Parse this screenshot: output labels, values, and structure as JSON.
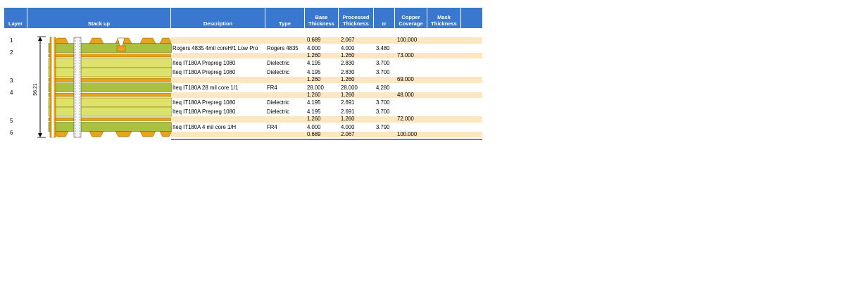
{
  "headers": {
    "layer": "Layer",
    "stackup": "Stack up",
    "description": "Description",
    "type": "Type",
    "base_thickness": "Base\nThickness",
    "processed_thickness": "Processed\nThickness",
    "er": "εr",
    "copper_coverage": "Copper\nCoverage",
    "mask_thickness": "Mask\nThickness"
  },
  "layers": [
    "1",
    "2",
    "3",
    "4",
    "5",
    "6"
  ],
  "total_thickness": "56.21",
  "rows": [
    {
      "kind": "cu",
      "description": "",
      "type": "",
      "base": "0.689",
      "processed": "2.067",
      "er": "",
      "coverage": "100.000"
    },
    {
      "kind": "die",
      "description": "Rogers 4835 4mil coreH/1 Low Pro",
      "type": "Rogers 4835",
      "base": "4.000",
      "processed": "4.000",
      "er": "3.480",
      "coverage": ""
    },
    {
      "kind": "cu",
      "description": "",
      "type": "",
      "base": "1.260",
      "processed": "1.260",
      "er": "",
      "coverage": "73.000"
    },
    {
      "kind": "die",
      "description": "Iteq IT180A Prepreg 1080",
      "type": "Dielectric",
      "base": "4.195",
      "processed": "2.830",
      "er": "3.700",
      "coverage": ""
    },
    {
      "kind": "die",
      "description": "Iteq IT180A Prepreg 1080",
      "type": "Dielectric",
      "base": "4.195",
      "processed": "2.830",
      "er": "3.700",
      "coverage": ""
    },
    {
      "kind": "cu",
      "description": "",
      "type": "",
      "base": "1.260",
      "processed": "1.260",
      "er": "",
      "coverage": "69.000"
    },
    {
      "kind": "die",
      "description": "Iteq IT180A 28 mil core 1/1",
      "type": "FR4",
      "base": "28.000",
      "processed": "28.000",
      "er": "4.280",
      "coverage": ""
    },
    {
      "kind": "cu",
      "description": "",
      "type": "",
      "base": "1.260",
      "processed": "1.260",
      "er": "",
      "coverage": "48.000"
    },
    {
      "kind": "die",
      "description": "Iteq IT180A Prepreg 1080",
      "type": "Dielectric",
      "base": "4.195",
      "processed": "2.691",
      "er": "3.700",
      "coverage": ""
    },
    {
      "kind": "die",
      "description": "Iteq IT180A Prepreg 1080",
      "type": "Dielectric",
      "base": "4.195",
      "processed": "2.691",
      "er": "3.700",
      "coverage": ""
    },
    {
      "kind": "cu",
      "description": "",
      "type": "",
      "base": "1.260",
      "processed": "1.260",
      "er": "",
      "coverage": "72.000"
    },
    {
      "kind": "die",
      "description": "Iteq IT180A  4 mil core 1/H",
      "type": "FR4",
      "base": "4.000",
      "processed": "4.000",
      "er": "3.790",
      "coverage": ""
    },
    {
      "kind": "cu",
      "description": "",
      "type": "",
      "base": "0.689",
      "processed": "2.067",
      "er": "",
      "coverage": "100.000"
    }
  ],
  "colors": {
    "header_bg": "#3a78cf",
    "copper_row_bg": "#fde7c1",
    "copper": "#e8a21c",
    "core": "#a9c040",
    "prepreg": "#dde26a",
    "via_fill": "#f5f5f5"
  }
}
